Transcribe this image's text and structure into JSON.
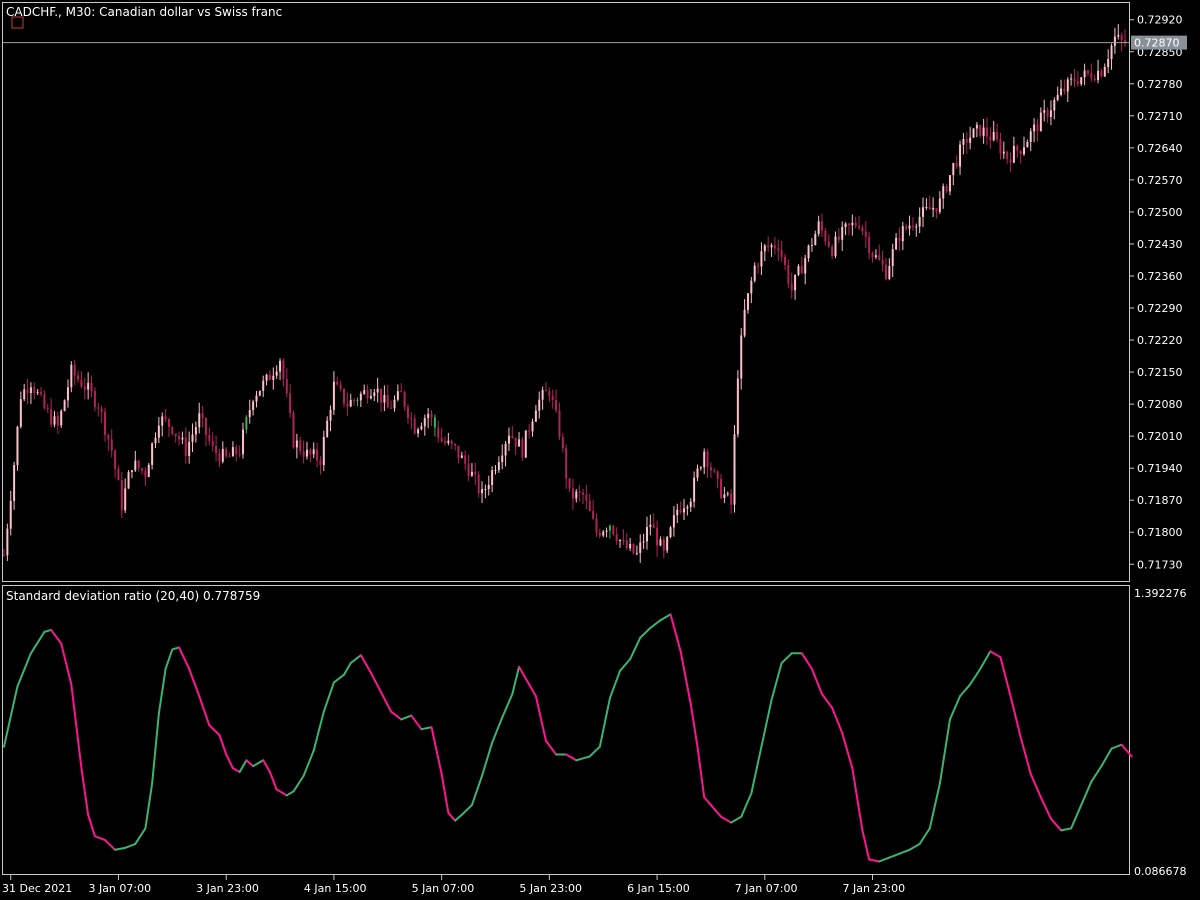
{
  "window": {
    "symbol_title": "CADCHF., M30:  Canadian dollar vs Swiss franc",
    "current_price": "0.72870"
  },
  "colors": {
    "background": "#000000",
    "frame": "#c8c8c8",
    "bull_candle": "#ffc0cb",
    "bear_candle": "#b0245a",
    "green_candle": "#3cb34a",
    "indicator_up": "#3cb371",
    "indicator_down": "#ff1493",
    "price_line": "#a0a0a0",
    "price_label_bg": "#8a9099"
  },
  "indicator": {
    "label": "Standard deviation ratio (20,40) 0.778759",
    "ymax_label": "1.392276",
    "ymin_label": "0.086678"
  },
  "chart_data": [
    {
      "type": "candlestick",
      "title": "CADCHF., M30:  Canadian dollar vs Swiss franc",
      "ylim": [
        0.717,
        0.7295
      ],
      "y_ticks": [
        "0.72920",
        "0.72850",
        "0.72780",
        "0.72710",
        "0.72640",
        "0.72570",
        "0.72500",
        "0.72430",
        "0.72360",
        "0.72290",
        "0.72220",
        "0.72150",
        "0.72080",
        "0.72010",
        "0.71940",
        "0.71870",
        "0.71800",
        "0.71730"
      ],
      "x_ticks": [
        "31 Dec 2021",
        "3 Jan 07:00",
        "3 Jan 23:00",
        "4 Jan 15:00",
        "5 Jan 07:00",
        "5 Jan 23:00",
        "6 Jan 15:00",
        "7 Jan 07:00",
        "7 Jan 23:00"
      ],
      "close_anchors": [
        [
          0,
          0.7175
        ],
        [
          3,
          0.7195
        ],
        [
          5,
          0.721
        ],
        [
          8,
          0.7213
        ],
        [
          12,
          0.7207
        ],
        [
          16,
          0.7203
        ],
        [
          20,
          0.7215
        ],
        [
          24,
          0.7212
        ],
        [
          28,
          0.7208
        ],
        [
          32,
          0.7198
        ],
        [
          35,
          0.7186
        ],
        [
          38,
          0.7195
        ],
        [
          42,
          0.7193
        ],
        [
          46,
          0.7205
        ],
        [
          50,
          0.7203
        ],
        [
          54,
          0.7198
        ],
        [
          58,
          0.7205
        ],
        [
          62,
          0.7198
        ],
        [
          66,
          0.7196
        ],
        [
          70,
          0.7198
        ],
        [
          74,
          0.721
        ],
        [
          78,
          0.7213
        ],
        [
          82,
          0.7218
        ],
        [
          86,
          0.72
        ],
        [
          90,
          0.7197
        ],
        [
          94,
          0.7196
        ],
        [
          98,
          0.7212
        ],
        [
          102,
          0.7208
        ],
        [
          106,
          0.721
        ],
        [
          110,
          0.7212
        ],
        [
          114,
          0.7207
        ],
        [
          118,
          0.721
        ],
        [
          122,
          0.7203
        ],
        [
          126,
          0.7206
        ],
        [
          130,
          0.72
        ],
        [
          134,
          0.7198
        ],
        [
          138,
          0.7194
        ],
        [
          142,
          0.7188
        ],
        [
          146,
          0.7195
        ],
        [
          150,
          0.7202
        ],
        [
          154,
          0.7198
        ],
        [
          158,
          0.7208
        ],
        [
          162,
          0.7211
        ],
        [
          165,
          0.7202
        ],
        [
          168,
          0.7188
        ],
        [
          172,
          0.7188
        ],
        [
          176,
          0.718
        ],
        [
          180,
          0.7182
        ],
        [
          184,
          0.7177
        ],
        [
          188,
          0.7175
        ],
        [
          192,
          0.7182
        ],
        [
          196,
          0.7175
        ],
        [
          200,
          0.7185
        ],
        [
          204,
          0.7188
        ],
        [
          208,
          0.7198
        ],
        [
          212,
          0.719
        ],
        [
          216,
          0.7186
        ],
        [
          218,
          0.7215
        ],
        [
          220,
          0.7228
        ],
        [
          223,
          0.7238
        ],
        [
          226,
          0.7242
        ],
        [
          230,
          0.7243
        ],
        [
          234,
          0.7233
        ],
        [
          238,
          0.724
        ],
        [
          242,
          0.7247
        ],
        [
          246,
          0.7242
        ],
        [
          250,
          0.7246
        ],
        [
          254,
          0.7248
        ],
        [
          258,
          0.7241
        ],
        [
          262,
          0.7237
        ],
        [
          266,
          0.7245
        ],
        [
          270,
          0.7248
        ],
        [
          274,
          0.725
        ],
        [
          278,
          0.7252
        ],
        [
          282,
          0.726
        ],
        [
          286,
          0.7266
        ],
        [
          290,
          0.7268
        ],
        [
          294,
          0.7266
        ],
        [
          298,
          0.7262
        ],
        [
          302,
          0.7264
        ],
        [
          306,
          0.7268
        ],
        [
          310,
          0.7272
        ],
        [
          314,
          0.7276
        ],
        [
          318,
          0.7279
        ],
        [
          322,
          0.728
        ],
        [
          326,
          0.7281
        ],
        [
          330,
          0.7288
        ],
        [
          332,
          0.7287
        ]
      ]
    },
    {
      "type": "line",
      "title": "Standard deviation ratio (20,40) 0.778759",
      "ylim": [
        0.086678,
        1.392276
      ],
      "y_ticks": [
        "1.392276",
        "0.086678"
      ],
      "series": [
        {
          "name": "Standard deviation ratio (20,40)",
          "points": [
            [
              0,
              0.7
            ],
            [
              4,
              1.01
            ],
            [
              8,
              1.18
            ],
            [
              12,
              1.29
            ],
            [
              14,
              1.3
            ],
            [
              17,
              1.23
            ],
            [
              20,
              1.02
            ],
            [
              23,
              0.59
            ],
            [
              25,
              0.35
            ],
            [
              27,
              0.24
            ],
            [
              30,
              0.22
            ],
            [
              33,
              0.17
            ],
            [
              36,
              0.18
            ],
            [
              39,
              0.2
            ],
            [
              42,
              0.28
            ],
            [
              44,
              0.51
            ],
            [
              46,
              0.87
            ],
            [
              48,
              1.1
            ],
            [
              50,
              1.2
            ],
            [
              52,
              1.21
            ],
            [
              55,
              1.1
            ],
            [
              58,
              0.96
            ],
            [
              61,
              0.81
            ],
            [
              64,
              0.76
            ],
            [
              66,
              0.66
            ],
            [
              68,
              0.59
            ],
            [
              70,
              0.57
            ],
            [
              72,
              0.63
            ],
            [
              74,
              0.6
            ],
            [
              77,
              0.63
            ],
            [
              79,
              0.57
            ],
            [
              81,
              0.48
            ],
            [
              84,
              0.45
            ],
            [
              86,
              0.47
            ],
            [
              89,
              0.55
            ],
            [
              92,
              0.68
            ],
            [
              95,
              0.88
            ],
            [
              98,
              1.03
            ],
            [
              101,
              1.07
            ],
            [
              103,
              1.13
            ],
            [
              106,
              1.17
            ],
            [
              109,
              1.08
            ],
            [
              112,
              0.98
            ],
            [
              115,
              0.88
            ],
            [
              118,
              0.84
            ],
            [
              121,
              0.86
            ],
            [
              124,
              0.79
            ],
            [
              127,
              0.8
            ],
            [
              130,
              0.56
            ],
            [
              132,
              0.36
            ],
            [
              134,
              0.32
            ],
            [
              136,
              0.35
            ],
            [
              139,
              0.4
            ],
            [
              142,
              0.55
            ],
            [
              145,
              0.72
            ],
            [
              148,
              0.85
            ],
            [
              151,
              0.97
            ],
            [
              153,
              1.11
            ],
            [
              155,
              1.05
            ],
            [
              158,
              0.96
            ],
            [
              161,
              0.73
            ],
            [
              164,
              0.66
            ],
            [
              167,
              0.66
            ],
            [
              170,
              0.63
            ],
            [
              174,
              0.65
            ],
            [
              177,
              0.7
            ],
            [
              180,
              0.95
            ],
            [
              183,
              1.09
            ],
            [
              186,
              1.15
            ],
            [
              189,
              1.26
            ],
            [
              192,
              1.31
            ],
            [
              195,
              1.35
            ],
            [
              198,
              1.38
            ],
            [
              201,
              1.19
            ],
            [
              204,
              0.92
            ],
            [
              206,
              0.7
            ],
            [
              208,
              0.44
            ],
            [
              210,
              0.4
            ],
            [
              213,
              0.34
            ],
            [
              216,
              0.31
            ],
            [
              219,
              0.34
            ],
            [
              222,
              0.46
            ],
            [
              225,
              0.7
            ],
            [
              228,
              0.94
            ],
            [
              231,
              1.13
            ],
            [
              234,
              1.18
            ],
            [
              237,
              1.18
            ],
            [
              240,
              1.1
            ],
            [
              243,
              0.97
            ],
            [
              246,
              0.9
            ],
            [
              249,
              0.77
            ],
            [
              252,
              0.59
            ],
            [
              255,
              0.27
            ],
            [
              257,
              0.12
            ],
            [
              260,
              0.11
            ],
            [
              263,
              0.13
            ],
            [
              266,
              0.15
            ],
            [
              269,
              0.17
            ],
            [
              272,
              0.2
            ],
            [
              275,
              0.28
            ],
            [
              278,
              0.51
            ],
            [
              281,
              0.84
            ],
            [
              284,
              0.96
            ],
            [
              287,
              1.02
            ],
            [
              290,
              1.1
            ],
            [
              293,
              1.19
            ],
            [
              296,
              1.16
            ],
            [
              299,
              0.96
            ],
            [
              302,
              0.75
            ],
            [
              305,
              0.56
            ],
            [
              308,
              0.44
            ],
            [
              311,
              0.33
            ],
            [
              314,
              0.27
            ],
            [
              317,
              0.28
            ],
            [
              320,
              0.4
            ],
            [
              323,
              0.52
            ],
            [
              326,
              0.6
            ],
            [
              329,
              0.69
            ],
            [
              332,
              0.71
            ],
            [
              335,
              0.65
            ]
          ]
        }
      ]
    }
  ]
}
